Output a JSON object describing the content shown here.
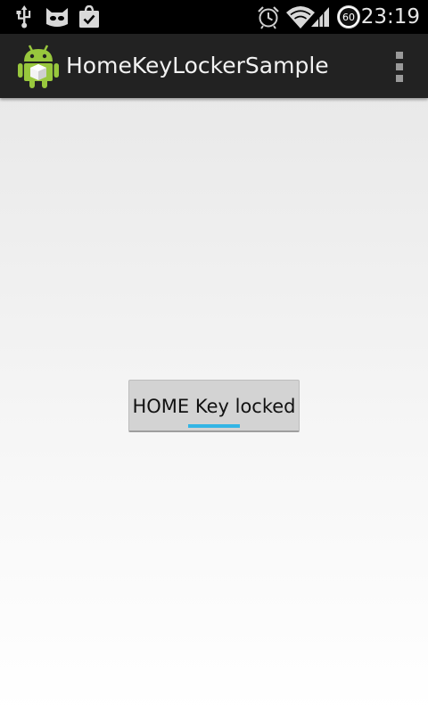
{
  "status_bar": {
    "time": "23:19",
    "battery_level": "60",
    "icons": [
      "usb-icon",
      "cyanogenmod-icon",
      "shopping-bag-check-icon",
      "alarm-clock-icon",
      "wifi-icon",
      "signal-icon",
      "battery-icon"
    ]
  },
  "action_bar": {
    "title": "HomeKeyLockerSample",
    "app_icon": "android-icon",
    "menu_icon": "overflow-menu-icon"
  },
  "main": {
    "toggle_button": {
      "label": "HOME Key locked",
      "state": "on",
      "indicator_color": "#33b5e5"
    }
  },
  "colors": {
    "status_bar_bg": "#000000",
    "action_bar_bg": "#222222",
    "accent": "#33b5e5"
  }
}
